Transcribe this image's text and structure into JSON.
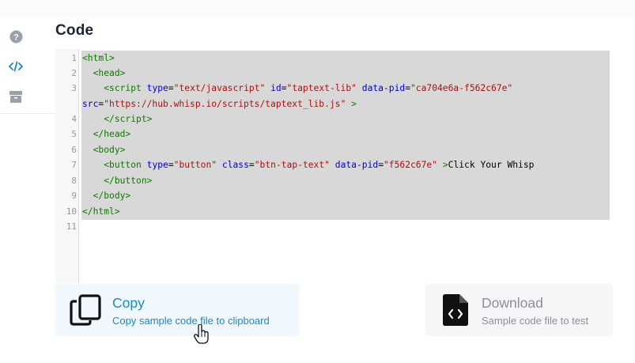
{
  "sidebar": {
    "items": [
      {
        "icon": "help-circle-icon",
        "active": false
      },
      {
        "icon": "code-icon",
        "active": true
      },
      {
        "icon": "package-icon",
        "active": false
      }
    ]
  },
  "section": {
    "title": "Code"
  },
  "editor": {
    "line_numbers": [
      "1",
      "2",
      "3",
      "4",
      "5",
      "6",
      "7",
      "8",
      "9",
      "10",
      "11"
    ]
  },
  "actions": {
    "copy": {
      "title": "Copy",
      "subtitle": "Copy sample code file to clipboard",
      "icon": "copy-icon"
    },
    "download": {
      "title": "Download",
      "subtitle": "Sample code file to test",
      "icon": "code-file-icon"
    }
  },
  "colors": {
    "accent": "#1b87c9",
    "icon_gray": "#9aa0aa",
    "code_tag": "#117700",
    "code_attr": "#0000cc",
    "code_string": "#aa1111"
  }
}
